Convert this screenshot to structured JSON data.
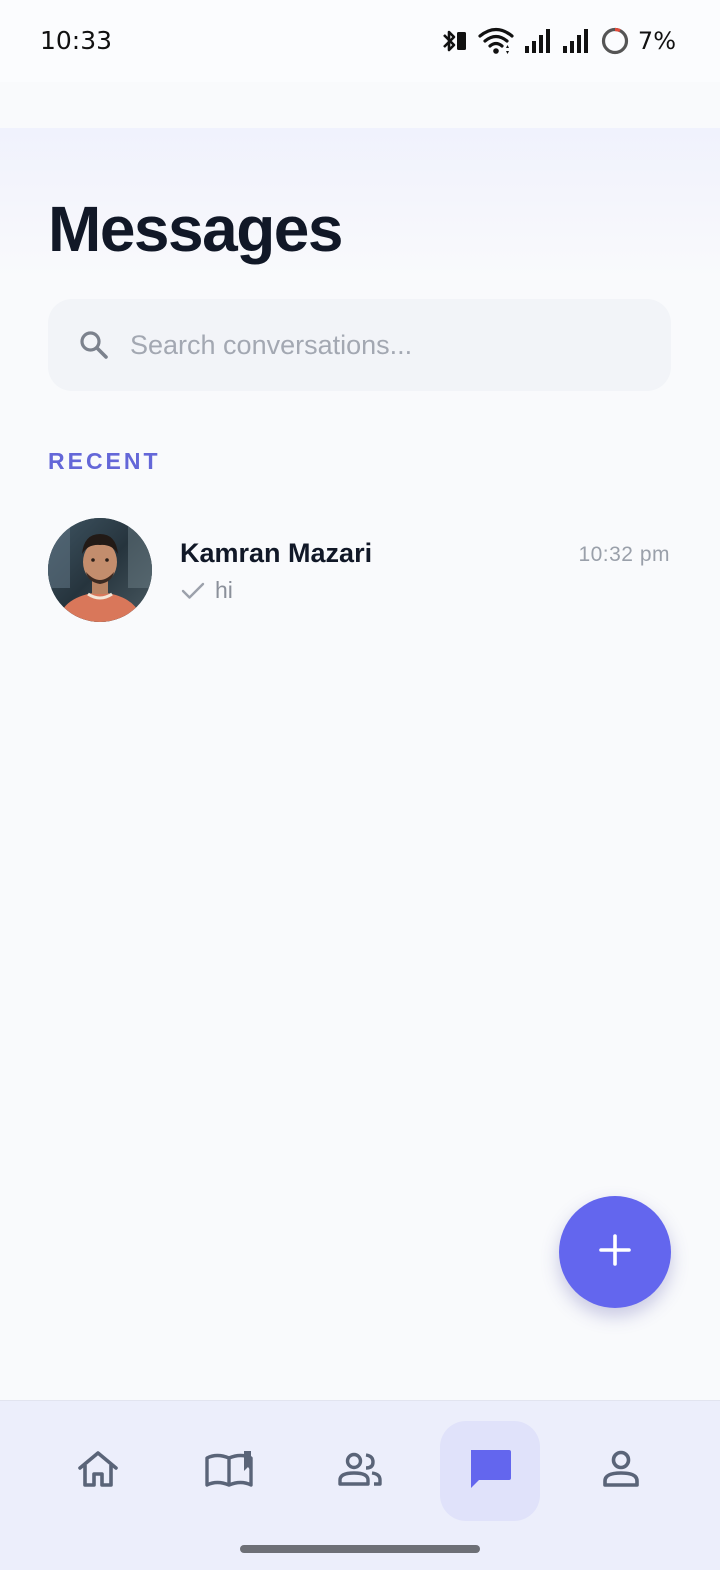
{
  "status_bar": {
    "time": "10:33",
    "battery_percent": "7%",
    "icons": [
      "bluetooth-icon",
      "wifi-icon",
      "signal-icon",
      "signal-icon",
      "battery-icon"
    ]
  },
  "header": {
    "title": "Messages"
  },
  "search": {
    "placeholder": "Search conversations...",
    "value": ""
  },
  "recent": {
    "label": "RECENT",
    "conversations": [
      {
        "name": "Kamran Mazari",
        "time": "10:32 pm",
        "last_message": "hi",
        "status_icon": "check-icon"
      }
    ]
  },
  "fab": {
    "icon": "plus-icon"
  },
  "bottom_nav": {
    "items": [
      {
        "icon": "home-icon",
        "active": false
      },
      {
        "icon": "book-icon",
        "active": false
      },
      {
        "icon": "people-icon",
        "active": false
      },
      {
        "icon": "chat-icon",
        "active": true
      },
      {
        "icon": "person-icon",
        "active": false
      }
    ]
  },
  "colors": {
    "accent": "#6366ee",
    "section_label": "#6467d8",
    "nav_active_bg": "#e0e2fa",
    "nav_icon": "#5a6478",
    "title": "#111827"
  }
}
